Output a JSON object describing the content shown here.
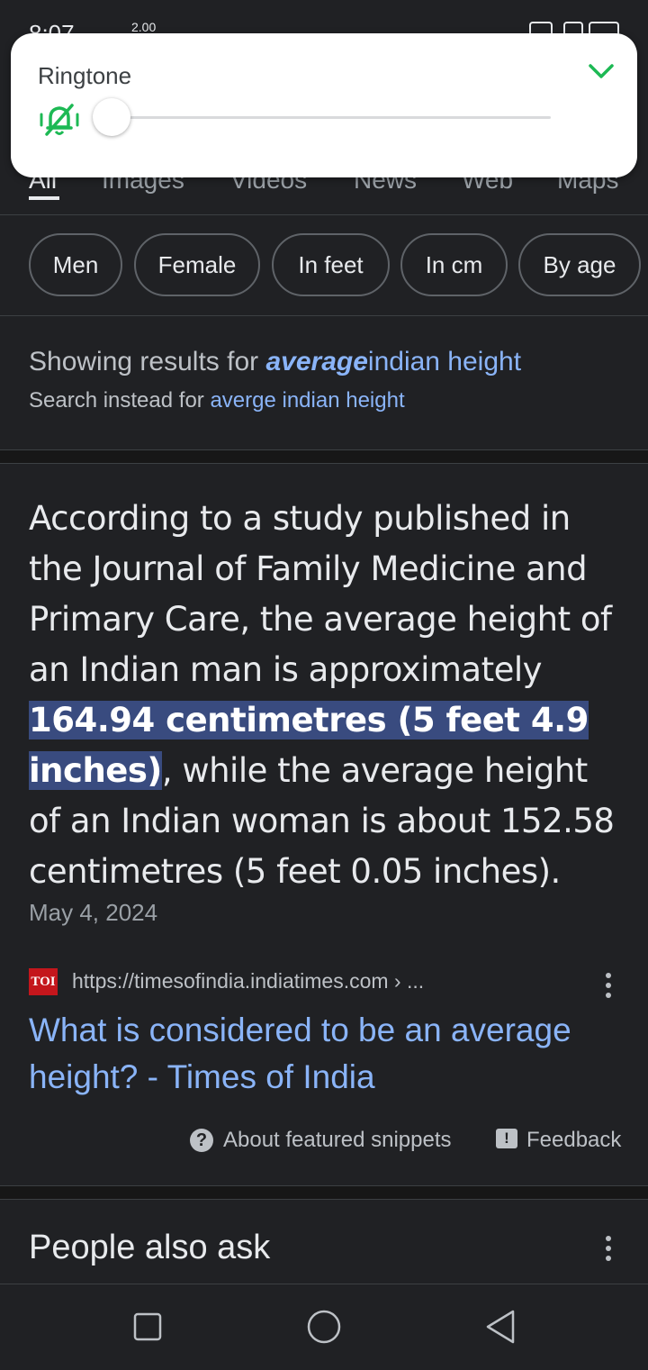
{
  "status_bar": {
    "time": "8:07",
    "speed": "2.00"
  },
  "ringtone": {
    "title": "Ringtone",
    "level": 0
  },
  "tabs": [
    "All",
    "Images",
    "Videos",
    "News",
    "Web",
    "Maps"
  ],
  "chips": [
    "Men",
    "Female",
    "In feet",
    "In cm",
    "By age"
  ],
  "spelling": {
    "showing_prefix": "Showing results for",
    "corrected_word": "average",
    "corrected_rest": "indian height",
    "instead_prefix": "Search instead for",
    "original_query": "averge indian height"
  },
  "snippet": {
    "text_before": "According to a study published in the Journal of Family Medicine and Primary Care, the average height of an Indian man is approximately ",
    "highlight": "164.94 centimetres (5 feet 4.9 inches)",
    "text_after": ", while the average height of an Indian woman is about 152.58 centimetres (5 feet 0.05 inches).",
    "date": "May 4, 2024"
  },
  "source": {
    "logo": "TOI",
    "url": "https://timesofindia.indiatimes.com › ...",
    "title": "What is considered to be an average height? - Times of India"
  },
  "footer": {
    "about": "About featured snippets",
    "feedback": "Feedback"
  },
  "people_also_ask": {
    "title": "People also ask"
  },
  "icons": {
    "ringtone": "muted-bell-icon",
    "collapse": "chevron-down-icon",
    "more": "more-vert-icon",
    "about": "help-icon",
    "feedback": "feedback-icon",
    "nav": [
      "recents-square-icon",
      "home-circle-icon",
      "back-triangle-icon"
    ]
  },
  "colors": {
    "accent": "#1db954",
    "link": "#8ab4f8",
    "highlight": "#394b7f",
    "background": "#202124"
  }
}
